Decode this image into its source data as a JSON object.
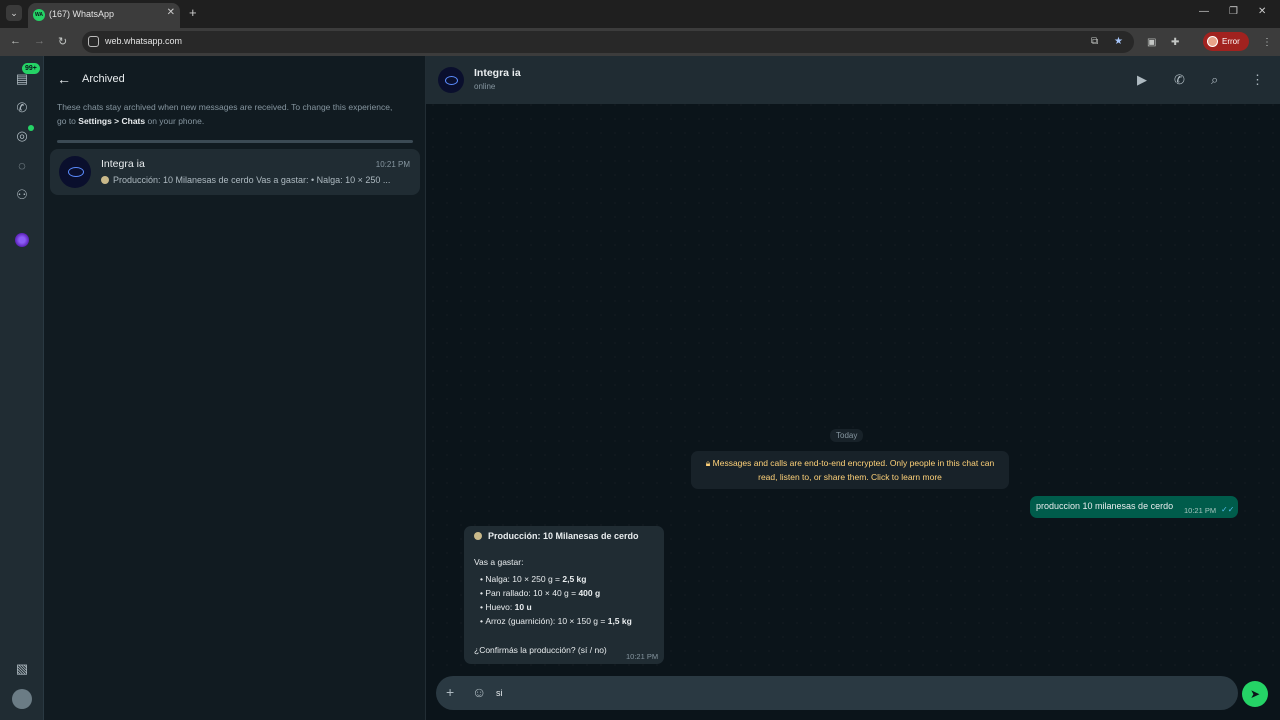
{
  "browser": {
    "tab_title": "(167) WhatsApp",
    "tab_favicon": "WA",
    "url": "web.whatsapp.com",
    "profile_label": "Error"
  },
  "rail": {
    "chats_badge": "99+"
  },
  "archived": {
    "title": "Archived",
    "info_prefix": "These chats stay archived when new messages are received. To change this experience, go to ",
    "info_link": "Settings > Chats",
    "info_suffix": " on your phone."
  },
  "chat_list": [
    {
      "name": "Integra ia",
      "time": "10:21 PM",
      "preview": "Producción: 10 Milanesas de cerdo Vas a gastar: • Nalga: 10 × 250 ..."
    }
  ],
  "conversation": {
    "name": "Integra ia",
    "status": "online",
    "date_chip": "Today",
    "system_message": "Messages and calls are end-to-end encrypted. Only people in this chat can read, listen to, or share them. Click to learn more",
    "outgoing": {
      "text": "produccion 10 milanesas de cerdo",
      "time": "10:21 PM"
    },
    "incoming": {
      "title": "Producción: 10 Milanesas de cerdo",
      "intro": "Vas a gastar:",
      "items": [
        {
          "label": "Nalga: 10 × 250 g = ",
          "value": "2,5 kg"
        },
        {
          "label": "Pan rallado: 10 × 40 g = ",
          "value": "400 g"
        },
        {
          "label": "Huevo: ",
          "value": "10 u"
        },
        {
          "label": "Arroz (guarnición): 10 × 150 g = ",
          "value": "1,5 kg"
        }
      ],
      "question": "¿Confirmás la producción? (sí / no)",
      "time": "10:21 PM"
    }
  },
  "composer": {
    "value": "si"
  },
  "colors": {
    "accent": "#25d366",
    "outgoing_bubble": "#005c4b",
    "incoming_bubble": "#202c33",
    "panel": "#111b21"
  }
}
